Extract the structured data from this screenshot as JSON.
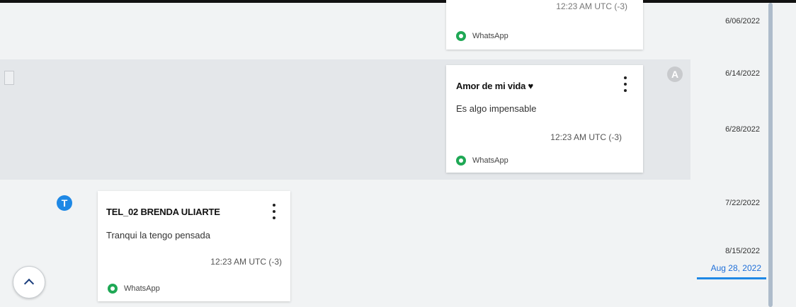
{
  "timeline": {
    "dates": [
      "6/06/2022",
      "6/14/2022",
      "6/28/2022",
      "7/22/2022",
      "8/15/2022"
    ],
    "current": "Aug 28, 2022"
  },
  "messages": [
    {
      "timestamp": "12:23 AM UTC (-3)",
      "source": "WhatsApp"
    },
    {
      "sender": "Amor de mi vida ♥",
      "avatar_letter": "A",
      "text": "Es algo impensable",
      "timestamp": "12:23 AM UTC (-3)",
      "source": "WhatsApp"
    },
    {
      "sender": "TEL_02 BRENDA ULIARTE",
      "avatar_letter": "T",
      "text": "Tranqui la tengo pensada",
      "timestamp": "12:23 AM UTC (-3)",
      "source": "WhatsApp"
    }
  ],
  "colors": {
    "accent": "#1e88e5",
    "whatsapp": "#1fa855",
    "highlight": "#e4e7ea"
  },
  "icons": {
    "whatsapp": "whatsapp-icon",
    "more": "more-vertical-icon",
    "scroll_up": "chevron-up-icon"
  }
}
